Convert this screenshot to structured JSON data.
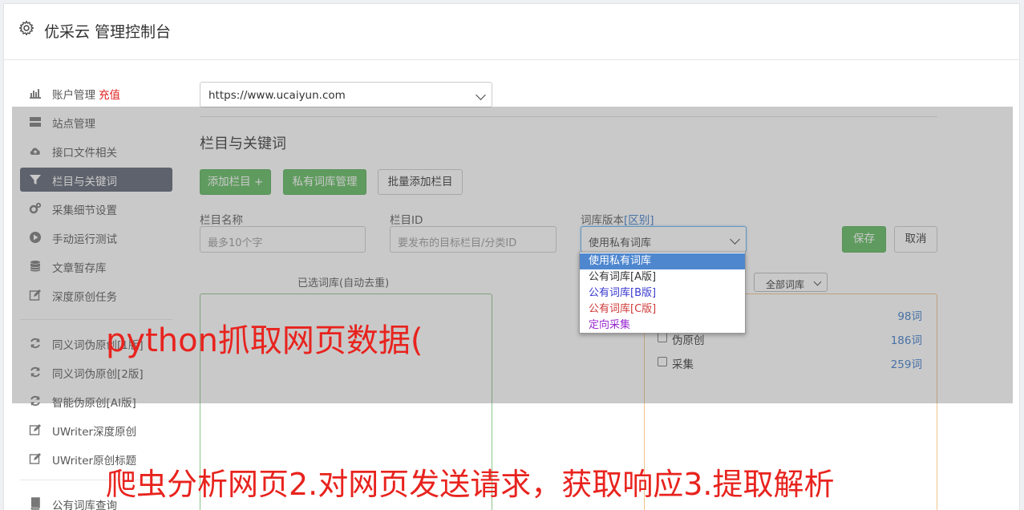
{
  "header": {
    "title": "优采云 管理控制台",
    "icon": "gear-icon"
  },
  "sidebar": {
    "items": [
      {
        "label": "账户管理",
        "extra": "充值",
        "icon": "bar-chart-icon"
      },
      {
        "label": "站点管理",
        "icon": "server-icon"
      },
      {
        "label": "接口文件相关",
        "icon": "cloud-upload-icon"
      },
      {
        "label": "栏目与关键词",
        "icon": "filter-icon",
        "active": true
      },
      {
        "label": "采集细节设置",
        "icon": "cogs-icon"
      },
      {
        "label": "手动运行测试",
        "icon": "play-circle-icon"
      },
      {
        "label": "文章暂存库",
        "icon": "database-icon"
      },
      {
        "label": "深度原创任务",
        "icon": "edit-icon"
      },
      {
        "label": "同义词伪原创[1版]",
        "icon": "refresh-icon"
      },
      {
        "label": "同义词伪原创[2版]",
        "icon": "refresh-icon"
      },
      {
        "label": "智能伪原创[AI版]",
        "icon": "refresh-icon"
      },
      {
        "label": "UWriter深度原创",
        "icon": "edit-icon"
      },
      {
        "label": "UWriter原创标题",
        "icon": "edit-icon"
      },
      {
        "label": "公有词库查询",
        "icon": "book-icon"
      }
    ]
  },
  "main": {
    "site_select": "https://www.ucaiyun.com",
    "section_title": "栏目与关键词",
    "buttons": {
      "add_column": "添加栏目 +",
      "private_lib": "私有词库管理",
      "batch_add": "批量添加栏目",
      "save": "保存",
      "cancel": "取消"
    },
    "form": {
      "name_label": "栏目名称",
      "name_placeholder": "最多10个字",
      "id_label": "栏目ID",
      "id_placeholder": "要发布的目标栏目/分类ID",
      "lib_label": "词库版本",
      "lib_label_link": "[区别]",
      "lib_value": "使用私有词库"
    },
    "selected_label": "已选词库(自动去重)",
    "filter_select": "全部词库",
    "libraries": [
      {
        "name": "",
        "count": "98词"
      },
      {
        "name": "伪原创",
        "count": "186词"
      },
      {
        "name": "采集",
        "count": "259词"
      }
    ],
    "dropdown_options": [
      {
        "label": "使用私有词库",
        "color": "#ffffff",
        "selected": true
      },
      {
        "label": "公有词库[A版]",
        "color": "#333333"
      },
      {
        "label": "公有词库[B版]",
        "color": "#3a3ad0"
      },
      {
        "label": "公有词库[C版]",
        "color": "#d03a3a"
      },
      {
        "label": "定向采集",
        "color": "#9a2ad0"
      }
    ]
  },
  "watermark": {
    "line1": "python抓取网页数据(",
    "line2": "爬虫分析网页2.对网页发送请求，获取响应3.提取解析"
  }
}
